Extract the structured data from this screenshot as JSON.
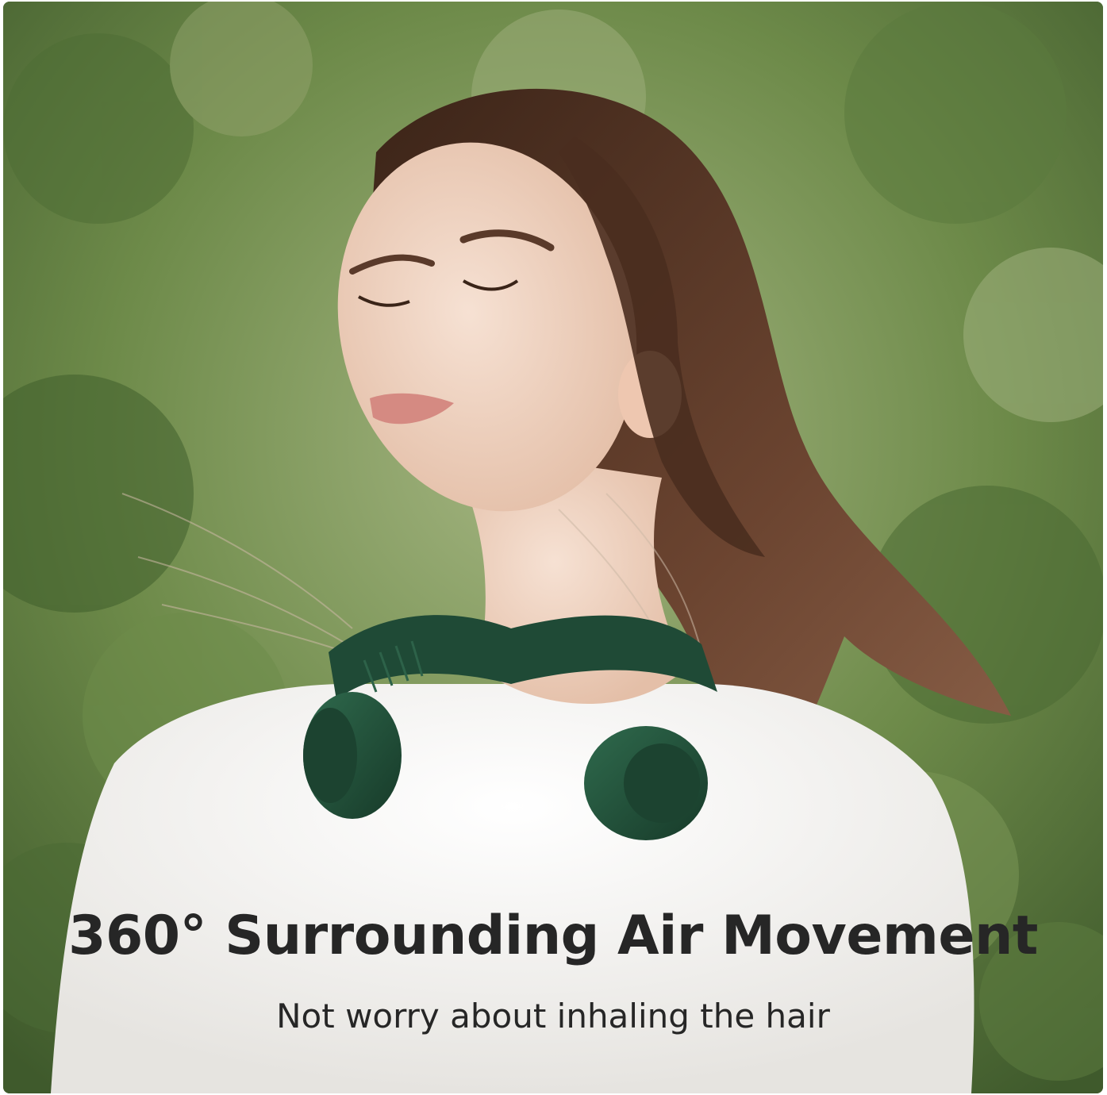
{
  "image": {
    "subject": "woman wearing a neck fan outdoors",
    "device_color": "#1f4a36",
    "background_color": "#6f8a4c",
    "shirt_color": "#f4f3f1",
    "hair_color": "#5a3a2a"
  },
  "caption": {
    "headline": "360° Surrounding Air Movement",
    "subline": "Not worry about inhaling the hair"
  }
}
